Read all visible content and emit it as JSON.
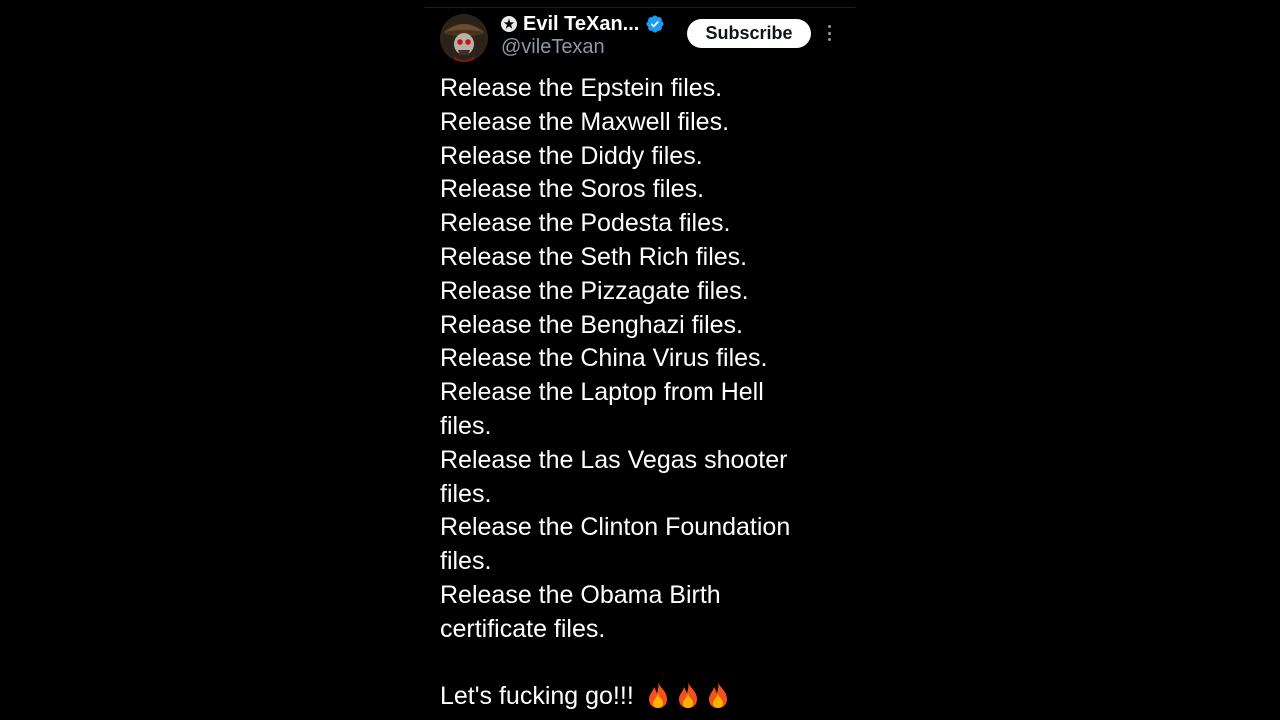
{
  "header": {
    "badge_icon": "star-circle-icon",
    "display_name": "Evil TeXan...",
    "verified_icon": "verified-badge-icon",
    "verified_color": "#1d9bf0",
    "handle": "@vileTexan",
    "subscribe_label": "Subscribe",
    "more_icon": "more-vertical-icon"
  },
  "tweet": {
    "lines": [
      "Release the Epstein files.",
      "Release the Maxwell files.",
      "Release the Diddy files.",
      "Release the Soros files.",
      "Release the Podesta files.",
      "Release the Seth Rich files.",
      "Release the Pizzagate files.",
      "Release the Benghazi files.",
      "Release the China Virus files.",
      "Release the Laptop from Hell",
      "files.",
      "Release the Las Vegas shooter",
      "files.",
      "Release the Clinton Foundation",
      "files.",
      "Release the Obama Birth",
      "certificate files."
    ],
    "closing": "Let's fucking go!!!",
    "closing_emoji_icon": "fire-icon",
    "closing_emoji_count": 3
  }
}
